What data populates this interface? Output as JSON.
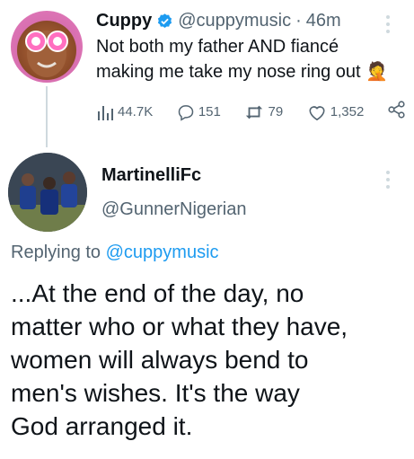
{
  "tweet": {
    "display_name": "Cuppy",
    "verified_color": "#1d9bf0",
    "handle": "@cuppymusic",
    "separator": "·",
    "time": "46m",
    "text_line1": "Not both my father AND fiancé",
    "text_line2": "making me take my nose ring out 🤦",
    "stats": {
      "views": "44.7K",
      "replies": "151",
      "retweets": "79",
      "likes": "1,352"
    }
  },
  "reply": {
    "display_name": "MartinelliFc",
    "handle": "@GunnerNigerian",
    "replying_prefix": "Replying to",
    "replying_to": "@cuppymusic",
    "text_lines": [
      "...At the end of the day, no",
      "matter who or what they have,",
      "women will always bend to",
      "men's wishes. It's the way",
      "God arranged it."
    ]
  },
  "colors": {
    "text": "#0f1419",
    "secondary": "#536471",
    "accent": "#1d9bf0",
    "thread_line": "#cfd9de"
  },
  "icons": {
    "views": "bar-chart-icon",
    "replies": "speech-bubble-icon",
    "retweets": "retweet-icon",
    "likes": "heart-icon",
    "share": "share-icon",
    "more": "more-vertical-icon",
    "verified": "verified-badge-icon"
  }
}
